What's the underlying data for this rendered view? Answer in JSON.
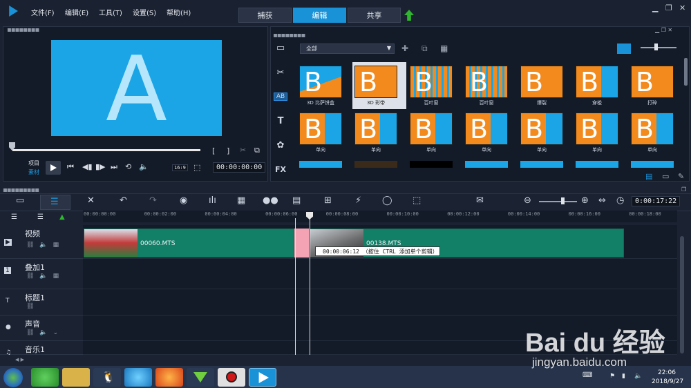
{
  "menu": {
    "items": [
      "文件(F)",
      "编辑(E)",
      "工具(T)",
      "设置(S)",
      "帮助(H)"
    ]
  },
  "modes": {
    "tabs": [
      "捕获",
      "编辑",
      "共享"
    ],
    "active": "编辑"
  },
  "window": {
    "minimize": "▁",
    "restore": "❐",
    "close": "✕"
  },
  "preview": {
    "letter": "A",
    "project_label": "项目",
    "clip_label": "素材",
    "timecode": "00:00:00:00",
    "aspect": "16:9",
    "bracket_in": "[",
    "bracket_out": "]",
    "screen_color": "#1ba5e6"
  },
  "library": {
    "category": "全部",
    "side_icons": [
      "media-icon",
      "instant-project-icon",
      "transition-icon",
      "title-icon",
      "graphic-icon",
      "filter-icon"
    ],
    "side_labels": [
      "▭",
      "✂",
      "AB",
      "T",
      "✿",
      "FX"
    ],
    "transitions": [
      {
        "name": "3D 比萨饼盒",
        "style": "pizza"
      },
      {
        "name": "3D 彩带",
        "style": "ribbon",
        "selected": true
      },
      {
        "name": "百叶窗",
        "style": "blinds"
      },
      {
        "name": "百叶窗",
        "style": "blinds2"
      },
      {
        "name": "爆裂",
        "style": "burst"
      },
      {
        "name": "穿梭",
        "style": "shuttle"
      },
      {
        "name": "打碎",
        "style": "shatter"
      },
      {
        "name": "单向",
        "style": "oneway"
      },
      {
        "name": "单向",
        "style": "oneway"
      },
      {
        "name": "单向",
        "style": "oneway"
      },
      {
        "name": "单向",
        "style": "oneway"
      },
      {
        "name": "单向",
        "style": "oneway"
      },
      {
        "name": "单向",
        "style": "oneway"
      },
      {
        "name": "单向",
        "style": "oneway"
      }
    ]
  },
  "timeline": {
    "timecode": "0:00:17:22",
    "ruler": [
      "00:00:00:00",
      "00:00:02:00",
      "00:00:04:00",
      "00:00:06:00",
      "00:00:08:00",
      "00:00:10:00",
      "00:00:12:00",
      "00:00:14:00",
      "00:00:16:00",
      "00:00:18:00"
    ],
    "tracks": [
      {
        "name": "视频",
        "icon": "video-track-icon"
      },
      {
        "name": "叠加1",
        "icon": "overlay-track-icon"
      },
      {
        "name": "标题1",
        "icon": "title-track-icon"
      },
      {
        "name": "声音",
        "icon": "voice-track-icon"
      },
      {
        "name": "音乐1",
        "icon": "music-track-icon"
      }
    ],
    "clips": [
      {
        "name": "00060.MTS"
      },
      {
        "name": "00138.MTS"
      }
    ],
    "tooltip": "00:00:06:12 （按住 CTRL 添加单个剪辑）"
  },
  "taskbar": {
    "time": "22:06",
    "date": "2018/9/27"
  },
  "watermark": {
    "brand": "Bai du 经验",
    "url": "jingyan.baidu.com"
  }
}
